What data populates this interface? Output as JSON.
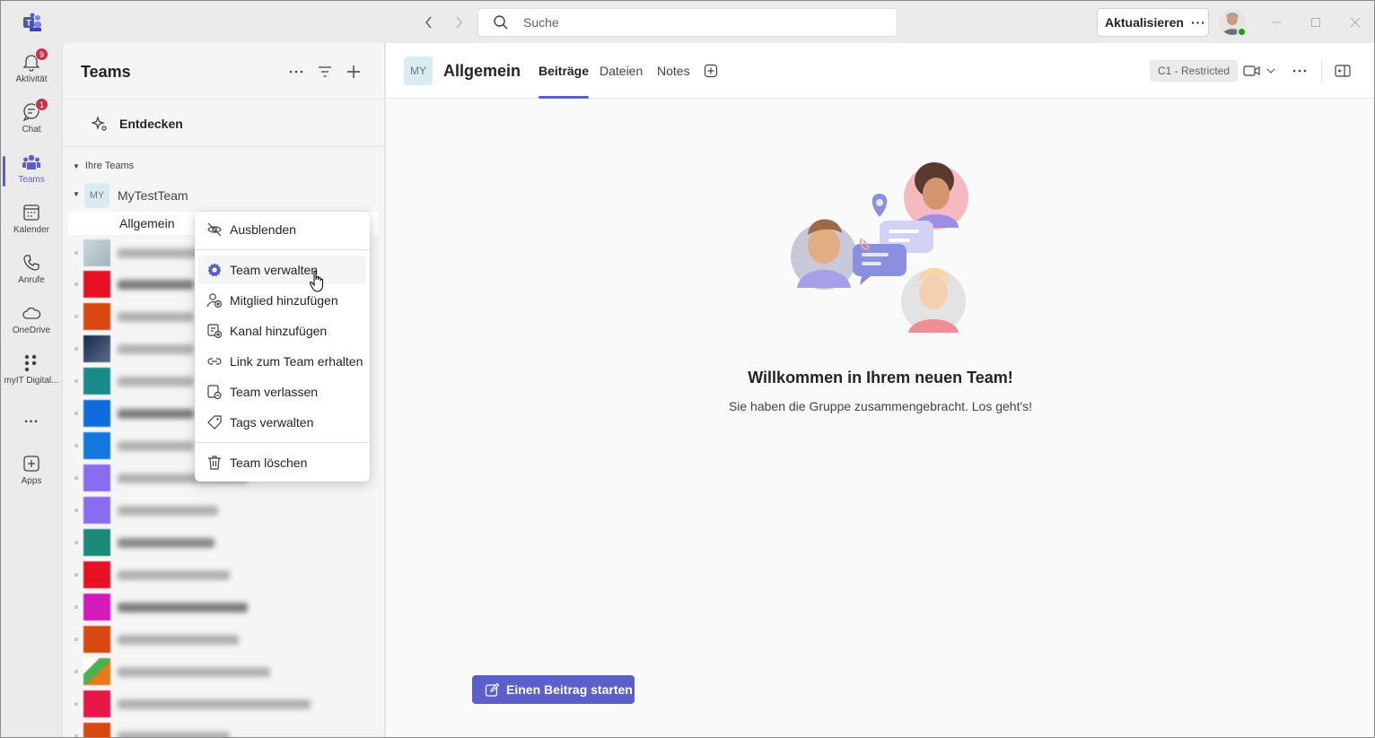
{
  "titlebar": {
    "search_placeholder": "Suche",
    "update_label": "Aktualisieren",
    "update_more": "···"
  },
  "rail": {
    "items": [
      {
        "label": "Aktivität",
        "icon": "bell-icon",
        "badge": "9"
      },
      {
        "label": "Chat",
        "icon": "chat-icon",
        "badge": "1"
      },
      {
        "label": "Teams",
        "icon": "teams-icon",
        "active": true
      },
      {
        "label": "Kalender",
        "icon": "calendar-icon"
      },
      {
        "label": "Anrufe",
        "icon": "phone-icon"
      },
      {
        "label": "OneDrive",
        "icon": "cloud-icon"
      },
      {
        "label": "myIT Digital...",
        "icon": "app-dots-icon"
      },
      {
        "label": "...",
        "icon": "more-icon"
      },
      {
        "label": "Apps",
        "icon": "apps-add-icon"
      }
    ]
  },
  "teams_panel": {
    "title": "Teams",
    "discover_label": "Entdecken",
    "section_label": "Ihre Teams",
    "team": {
      "initials": "MY",
      "name": "MyTestTeam"
    },
    "channel": {
      "name": "Allgemein"
    }
  },
  "context_menu": {
    "items": [
      {
        "label": "Ausblenden",
        "icon": "eye-off-icon"
      },
      {
        "label": "Team verwalten",
        "icon": "gear-icon"
      },
      {
        "label": "Mitglied hinzufügen",
        "icon": "person-add-icon"
      },
      {
        "label": "Kanal hinzufügen",
        "icon": "channel-add-icon"
      },
      {
        "label": "Link zum Team erhalten",
        "icon": "link-icon"
      },
      {
        "label": "Team verlassen",
        "icon": "leave-icon"
      },
      {
        "label": "Tags verwalten",
        "icon": "tag-icon"
      },
      {
        "label": "Team löschen",
        "icon": "trash-icon"
      }
    ]
  },
  "main": {
    "channel_initials": "MY",
    "channel_title": "Allgemein",
    "tabs": [
      {
        "label": "Beiträge",
        "active": true
      },
      {
        "label": "Dateien"
      },
      {
        "label": "Notes"
      }
    ],
    "sensitivity_label": "C1 - Restricted",
    "welcome_title": "Willkommen in Ihrem neuen Team!",
    "welcome_subtitle": "Sie haben die Gruppe zusammengebracht. Los geht's!",
    "start_post_label": "Einen Beitrag starten"
  },
  "colors": {
    "accent": "#5b5fc7",
    "badge": "#c4314b",
    "presence": "#13a10e"
  }
}
